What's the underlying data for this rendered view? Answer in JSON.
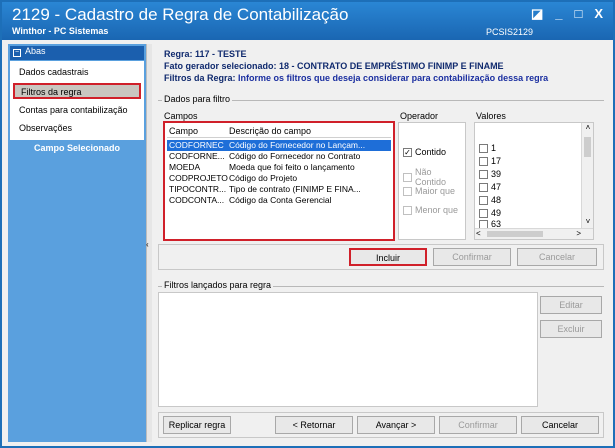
{
  "window": {
    "title": "2129 - Cadastro de Regra de Contabilização",
    "subtitle": "Winthor - PC Sistemas",
    "code": "PCSIS2129",
    "controls": [
      "◪",
      "_",
      "□",
      "X"
    ]
  },
  "sidebar": {
    "abas_label": "Abas",
    "items": [
      {
        "label": "Dados cadastrais"
      },
      {
        "label": "Filtros da regra"
      },
      {
        "label": "Contas para contabilização"
      },
      {
        "label": "Observações"
      }
    ],
    "campo_selecionado": "Campo Selecionado"
  },
  "header": {
    "regra_label": "Regra:",
    "regra_value": "117 - TESTE",
    "fato_label": "Fato gerador selecionado:",
    "fato_value": "18 - CONTRATO DE EMPRÉSTIMO FINIMP E FINAME",
    "filtros_label": "Filtros da Regra:",
    "filtros_value": "Informe os filtros que deseja considerar para contabilização dessa regra"
  },
  "dados_filtro": {
    "group_label": "Dados para filtro",
    "campos_label": "Campos",
    "operador_label": "Operador",
    "valores_label": "Valores",
    "columns": [
      "Campo",
      "Descrição do campo"
    ],
    "rows": [
      {
        "campo": "CODFORNEC",
        "descricao": "Código do Fornecedor no Lançam..."
      },
      {
        "campo": "CODFORNE...",
        "descricao": "Código do Fornecedor no Contrato"
      },
      {
        "campo": "MOEDA",
        "descricao": "Moeda que foi feito o lançamento"
      },
      {
        "campo": "CODPROJETO",
        "descricao": "Código do Projeto"
      },
      {
        "campo": "TIPOCONTR...",
        "descricao": "Tipo de contrato (FINIMP E FINA..."
      },
      {
        "campo": "CODCONTA...",
        "descricao": "Código da Conta Gerencial"
      }
    ],
    "operadores": [
      {
        "label": "Contido",
        "checked": true,
        "enabled": true
      },
      {
        "label": "Não Contido",
        "checked": false,
        "enabled": false
      },
      {
        "label": "Maior que",
        "checked": false,
        "enabled": false
      },
      {
        "label": "Menor que",
        "checked": false,
        "enabled": false
      }
    ],
    "valores": [
      "1",
      "17",
      "39",
      "47",
      "48",
      "49",
      "63"
    ]
  },
  "buttons": {
    "incluir": "Incluir",
    "confirmar": "Confirmar",
    "cancelar": "Cancelar",
    "editar": "Editar",
    "excluir": "Excluir"
  },
  "filtros_lancados": {
    "group_label": "Filtros lançados para regra"
  },
  "bottom": {
    "replicar": "Replicar regra",
    "retornar": "< Retornar",
    "avancar": "Avançar >",
    "confirmar": "Confirmar",
    "cancelar": "Cancelar"
  },
  "colors": {
    "titlebar": "#1a66b2",
    "highlight_red": "#d0202a",
    "selection_blue": "#1e6ed8",
    "sidebar_bg": "#5aa0de"
  }
}
